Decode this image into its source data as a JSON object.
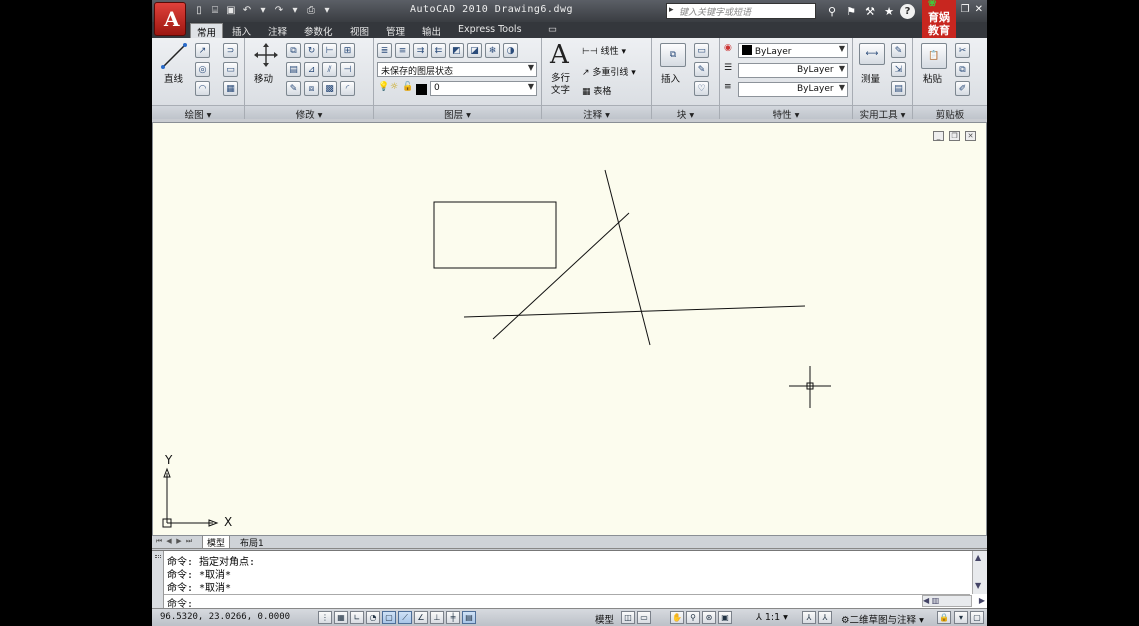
{
  "window": {
    "logo_letter": "A",
    "title": "AutoCAD 2010  Drawing6.dwg",
    "search_placeholder": "键入关键字或短语",
    "brand_line1": "育娲",
    "brand_line2": "教育",
    "controls": [
      "_",
      "❐",
      "✕"
    ]
  },
  "quick_access": [
    "new-icon",
    "open-icon",
    "save-icon",
    "undo-icon",
    "redo-icon",
    "plot-icon"
  ],
  "tabs": [
    "常用",
    "插入",
    "注释",
    "参数化",
    "视图",
    "管理",
    "输出",
    "Express Tools"
  ],
  "active_tab": "常用",
  "ribbon": {
    "draw": {
      "title": "绘图",
      "line_label": "直线"
    },
    "modify": {
      "title": "修改",
      "move_label": "移动"
    },
    "layers": {
      "title": "图层",
      "state_combo": "未保存的图层状态",
      "layer_combo": "0"
    },
    "annotation": {
      "title": "注释",
      "text_label_1": "多行",
      "text_label_2": "文字",
      "linear": "线性",
      "mleader": "多重引线",
      "table": "表格"
    },
    "block": {
      "title": "块",
      "insert_label": "插入"
    },
    "properties": {
      "title": "特性",
      "color": "ByLayer",
      "linetype": "ByLayer",
      "lineweight": "ByLayer"
    },
    "utilities": {
      "title": "实用工具",
      "measure_label": "测量"
    },
    "clipboard": {
      "title": "剪贴板",
      "paste_label": "粘贴"
    }
  },
  "viewport": {
    "ucs_y": "Y",
    "ucs_x": "X",
    "controls": [
      "_",
      "❐",
      "✕"
    ]
  },
  "layout_tabs": {
    "model": "模型",
    "layout1": "布局1"
  },
  "command_history": [
    "命令: 指定对角点:",
    "命令: *取消*",
    "命令: *取消*"
  ],
  "command_prompt": "命令:",
  "status": {
    "coords": "96.5320,  23.0266, 0.0000",
    "model_label": "模型",
    "scale_label": "1:1",
    "workspace_label": "二维草图与注释"
  }
}
